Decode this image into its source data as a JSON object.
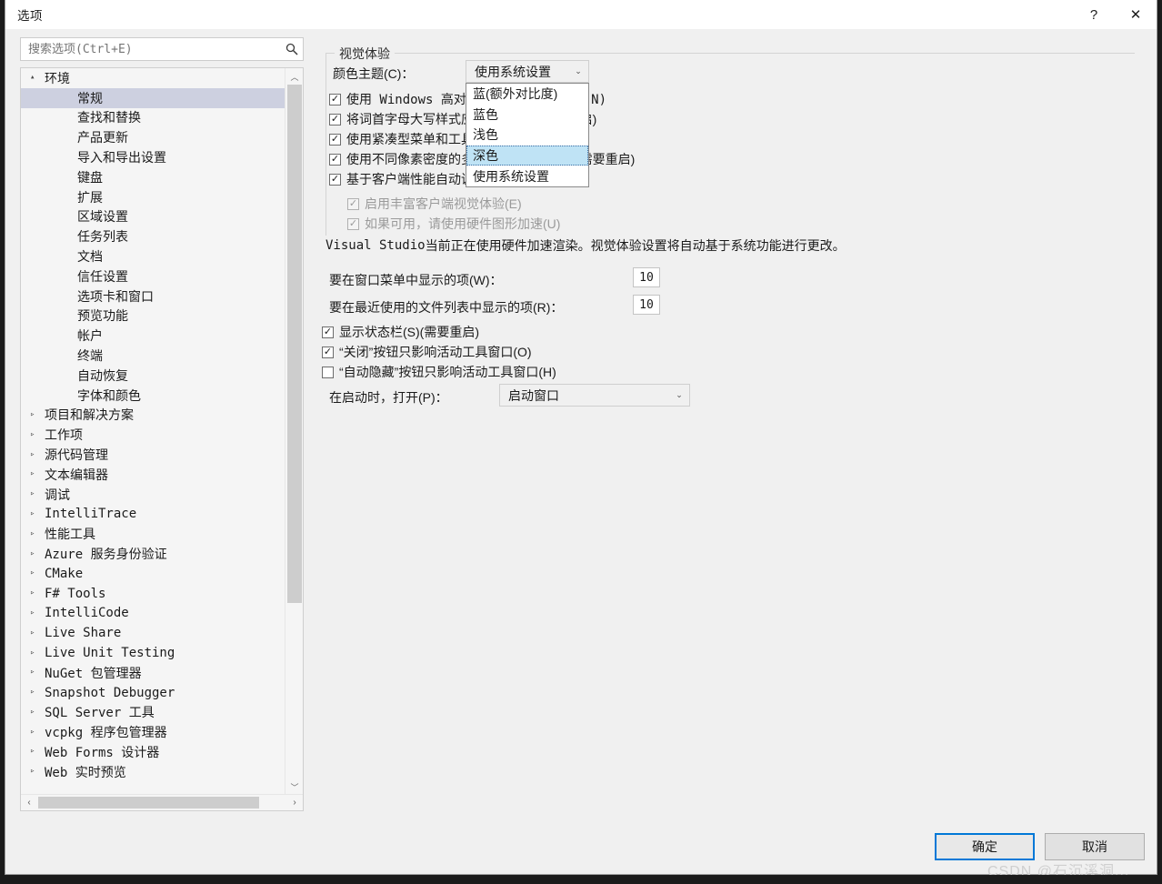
{
  "window": {
    "title": "选项",
    "help_icon": "?",
    "close_icon": "✕"
  },
  "search": {
    "placeholder": "搜索选项(Ctrl+E)",
    "value": "",
    "icon": "search-icon"
  },
  "tree": {
    "items": [
      {
        "label": "环境",
        "level": 0,
        "twisty": "▴",
        "selected": false
      },
      {
        "label": "常规",
        "level": 1,
        "twisty": "",
        "selected": true
      },
      {
        "label": "查找和替换",
        "level": 1,
        "twisty": "",
        "selected": false
      },
      {
        "label": "产品更新",
        "level": 1,
        "twisty": "",
        "selected": false
      },
      {
        "label": "导入和导出设置",
        "level": 1,
        "twisty": "",
        "selected": false
      },
      {
        "label": "键盘",
        "level": 1,
        "twisty": "",
        "selected": false
      },
      {
        "label": "扩展",
        "level": 1,
        "twisty": "",
        "selected": false
      },
      {
        "label": "区域设置",
        "level": 1,
        "twisty": "",
        "selected": false
      },
      {
        "label": "任务列表",
        "level": 1,
        "twisty": "",
        "selected": false
      },
      {
        "label": "文档",
        "level": 1,
        "twisty": "",
        "selected": false
      },
      {
        "label": "信任设置",
        "level": 1,
        "twisty": "",
        "selected": false
      },
      {
        "label": "选项卡和窗口",
        "level": 1,
        "twisty": "",
        "selected": false
      },
      {
        "label": "预览功能",
        "level": 1,
        "twisty": "",
        "selected": false
      },
      {
        "label": "帐户",
        "level": 1,
        "twisty": "",
        "selected": false
      },
      {
        "label": "终端",
        "level": 1,
        "twisty": "",
        "selected": false
      },
      {
        "label": "自动恢复",
        "level": 1,
        "twisty": "",
        "selected": false
      },
      {
        "label": "字体和颜色",
        "level": 1,
        "twisty": "",
        "selected": false
      },
      {
        "label": "项目和解决方案",
        "level": 0,
        "twisty": "▹",
        "selected": false
      },
      {
        "label": "工作项",
        "level": 0,
        "twisty": "▹",
        "selected": false
      },
      {
        "label": "源代码管理",
        "level": 0,
        "twisty": "▹",
        "selected": false
      },
      {
        "label": "文本编辑器",
        "level": 0,
        "twisty": "▹",
        "selected": false
      },
      {
        "label": "调试",
        "level": 0,
        "twisty": "▹",
        "selected": false
      },
      {
        "label": "IntelliTrace",
        "level": 0,
        "twisty": "▹",
        "selected": false
      },
      {
        "label": "性能工具",
        "level": 0,
        "twisty": "▹",
        "selected": false
      },
      {
        "label": "Azure 服务身份验证",
        "level": 0,
        "twisty": "▹",
        "selected": false
      },
      {
        "label": "CMake",
        "level": 0,
        "twisty": "▹",
        "selected": false
      },
      {
        "label": "F# Tools",
        "level": 0,
        "twisty": "▹",
        "selected": false
      },
      {
        "label": "IntelliCode",
        "level": 0,
        "twisty": "▹",
        "selected": false
      },
      {
        "label": "Live Share",
        "level": 0,
        "twisty": "▹",
        "selected": false
      },
      {
        "label": "Live Unit Testing",
        "level": 0,
        "twisty": "▹",
        "selected": false
      },
      {
        "label": "NuGet 包管理器",
        "level": 0,
        "twisty": "▹",
        "selected": false
      },
      {
        "label": "Snapshot Debugger",
        "level": 0,
        "twisty": "▹",
        "selected": false
      },
      {
        "label": "SQL Server 工具",
        "level": 0,
        "twisty": "▹",
        "selected": false
      },
      {
        "label": "vcpkg 程序包管理器",
        "level": 0,
        "twisty": "▹",
        "selected": false
      },
      {
        "label": "Web Forms 设计器",
        "level": 0,
        "twisty": "▹",
        "selected": false
      },
      {
        "label": "Web 实时预览",
        "level": 0,
        "twisty": "▹",
        "selected": false
      }
    ],
    "scroll_up_icon": "︿",
    "scroll_down_icon": "﹀",
    "scroll_left_icon": "‹",
    "scroll_right_icon": "›"
  },
  "visual_group": {
    "title": "视觉体验",
    "theme_label": "颜色主题(C)：",
    "theme_value": "使用系统设置",
    "dropdown_arrow": "⌄",
    "options": [
      {
        "label": "蓝(额外对比度)",
        "selected": false
      },
      {
        "label": "蓝色",
        "selected": false
      },
      {
        "label": "浅色",
        "selected": false
      },
      {
        "label": "深色",
        "selected": true
      },
      {
        "label": "使用系统设置",
        "selected": false
      }
    ],
    "checkboxes": [
      {
        "label": "使用 Windows 高对比度设置(需要重启)(N)",
        "checked": true,
        "disabled": false
      },
      {
        "label": "将词首字母大写样式应用于菜单栏(需要重启)",
        "checked": true,
        "disabled": false
      },
      {
        "label": "使用紧凑型菜单和工具栏(需要重启)",
        "checked": true,
        "disabled": false
      },
      {
        "label": "使用不同像素密度的多个显示器进行优化(需要重启)",
        "checked": true,
        "disabled": false
      },
      {
        "label": "基于客户端性能自动调整视觉体验",
        "checked": true,
        "disabled": false
      },
      {
        "label": "启用丰富客户端视觉体验(E)",
        "checked": true,
        "disabled": true
      },
      {
        "label": "如果可用，请使用硬件图形加速(U)",
        "checked": true,
        "disabled": true
      }
    ],
    "info_text_mono": "Visual Studio ",
    "info_text": "当前正在使用硬件加速渲染。视觉体验设置将自动基于系统功能进行更改。",
    "check_glyph": "✓"
  },
  "general_settings": {
    "window_menu_items_label": "要在窗口菜单中显示的项(W)：",
    "window_menu_items_value": "10",
    "recent_files_label": "要在最近使用的文件列表中显示的项(R)：",
    "recent_files_value": "10",
    "checkboxes": [
      {
        "label": "显示状态栏(S)(需要重启)",
        "checked": true
      },
      {
        "label": "“关闭”按钮只影响活动工具窗口(O)",
        "checked": true
      },
      {
        "label": "“自动隐藏”按钮只影响活动工具窗口(H)",
        "checked": false
      }
    ],
    "startup_label": "在启动时，打开(P)：",
    "startup_value": "启动窗口",
    "dropdown_arrow": "⌄"
  },
  "footer": {
    "ok_label": "确定",
    "cancel_label": "取消"
  },
  "watermark": {
    "text": "CSDN @石沉溪洞..."
  },
  "colors": {
    "accent": "#0078d7",
    "selection": "#cdd0e0",
    "dropdown_highlight": "#bfe3f5",
    "dialog_bg": "#f0f0f0",
    "backdrop": "#1b1b1b"
  }
}
